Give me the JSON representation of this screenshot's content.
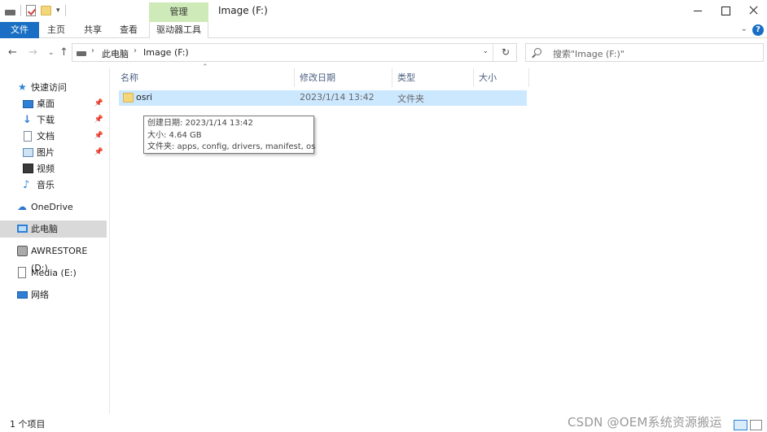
{
  "titlebar": {
    "contextual_tab": "管理",
    "title": "Image (F:)"
  },
  "ribbon": {
    "tabs": [
      "文件",
      "主页",
      "共享",
      "查看",
      "驱动器工具"
    ],
    "help": "?"
  },
  "address": {
    "crumbs": [
      "此电脑",
      "Image (F:)"
    ]
  },
  "search": {
    "placeholder": "搜索\"Image (F:)\""
  },
  "sidebar": {
    "quick_access": "快速访问",
    "items": [
      "桌面",
      "下载",
      "文档",
      "图片",
      "视频",
      "音乐"
    ],
    "onedrive": "OneDrive",
    "this_pc": "此电脑",
    "drives": [
      "AWRESTORE (D:)",
      "Media (E:)"
    ],
    "network": "网络"
  },
  "columns": [
    "名称",
    "修改日期",
    "类型",
    "大小"
  ],
  "files": [
    {
      "name": "osri",
      "modified": "2023/1/14 13:42",
      "type": "文件夹"
    }
  ],
  "tooltip": {
    "line1": "创建日期: 2023/1/14 13:42",
    "line2": "大小: 4.64 GB",
    "line3": "文件夹: apps, config, drivers, manifest, os"
  },
  "status": {
    "count": "1 个项目"
  },
  "watermark": "CSDN @OEM系统资源搬运",
  "colors": {
    "accent": "#1a6fc4",
    "manage_tab": "#cdeab8",
    "selection": "#cce8ff",
    "folder": "#f5d77b"
  }
}
